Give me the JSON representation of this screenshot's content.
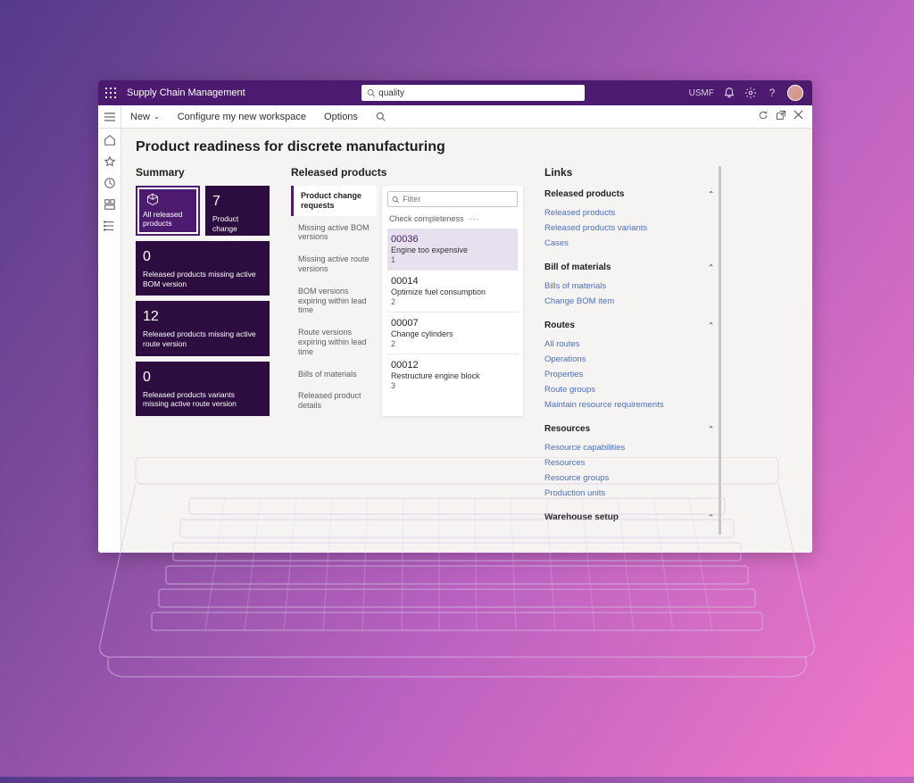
{
  "header": {
    "brand": "Supply Chain Management",
    "search_value": "quality",
    "entity": "USMF"
  },
  "commandbar": {
    "new": "New",
    "configure": "Configure my new workspace",
    "options": "Options"
  },
  "page_title": "Product readiness for discrete manufacturing",
  "sections": {
    "summary": "Summary",
    "released": "Released products",
    "links": "Links"
  },
  "tiles": [
    {
      "id": "all",
      "value": "",
      "label": "All released products",
      "hasIcon": true,
      "selected": true
    },
    {
      "id": "changereq",
      "value": "7",
      "label": "Product change requests"
    },
    {
      "id": "miss-bom",
      "value": "0",
      "label": "Released products missing active BOM version"
    },
    {
      "id": "miss-route",
      "value": "12",
      "label": "Released products missing active route version"
    },
    {
      "id": "variants-miss",
      "value": "0",
      "label": "Released products variants missing active route version"
    }
  ],
  "filter_tabs": [
    {
      "label": "Product change requests",
      "active": true
    },
    {
      "label": "Missing active BOM versions"
    },
    {
      "label": "Missing active route versions"
    },
    {
      "label": "BOM versions expiring within lead time"
    },
    {
      "label": "Route versions expiring within lead time"
    },
    {
      "label": "Bills of materials"
    },
    {
      "label": "Released product details"
    }
  ],
  "listbox": {
    "filter_placeholder": "Filter",
    "check_label": "Check completeness"
  },
  "requests": [
    {
      "id": "00036",
      "title": "Engine too expensive",
      "count": "1",
      "selected": true
    },
    {
      "id": "00014",
      "title": "Optimize fuel consumption",
      "count": "2"
    },
    {
      "id": "00007",
      "title": "Change cylinders",
      "count": "2"
    },
    {
      "id": "00012",
      "title": "Restructure engine block",
      "count": "3"
    }
  ],
  "link_groups": [
    {
      "title": "Released products",
      "items": [
        "Released products",
        "Released products variants",
        "Cases"
      ]
    },
    {
      "title": "Bill of materials",
      "items": [
        "Bills of materials",
        "Change BOM item"
      ]
    },
    {
      "title": "Routes",
      "items": [
        "All routes",
        "Operations",
        "Properties",
        "Route groups",
        "Maintain resource requirements"
      ]
    },
    {
      "title": "Resources",
      "items": [
        "Resource capabilities",
        "Resources",
        "Resource groups",
        "Production units"
      ]
    },
    {
      "title": "Warehouse setup",
      "items": []
    }
  ]
}
